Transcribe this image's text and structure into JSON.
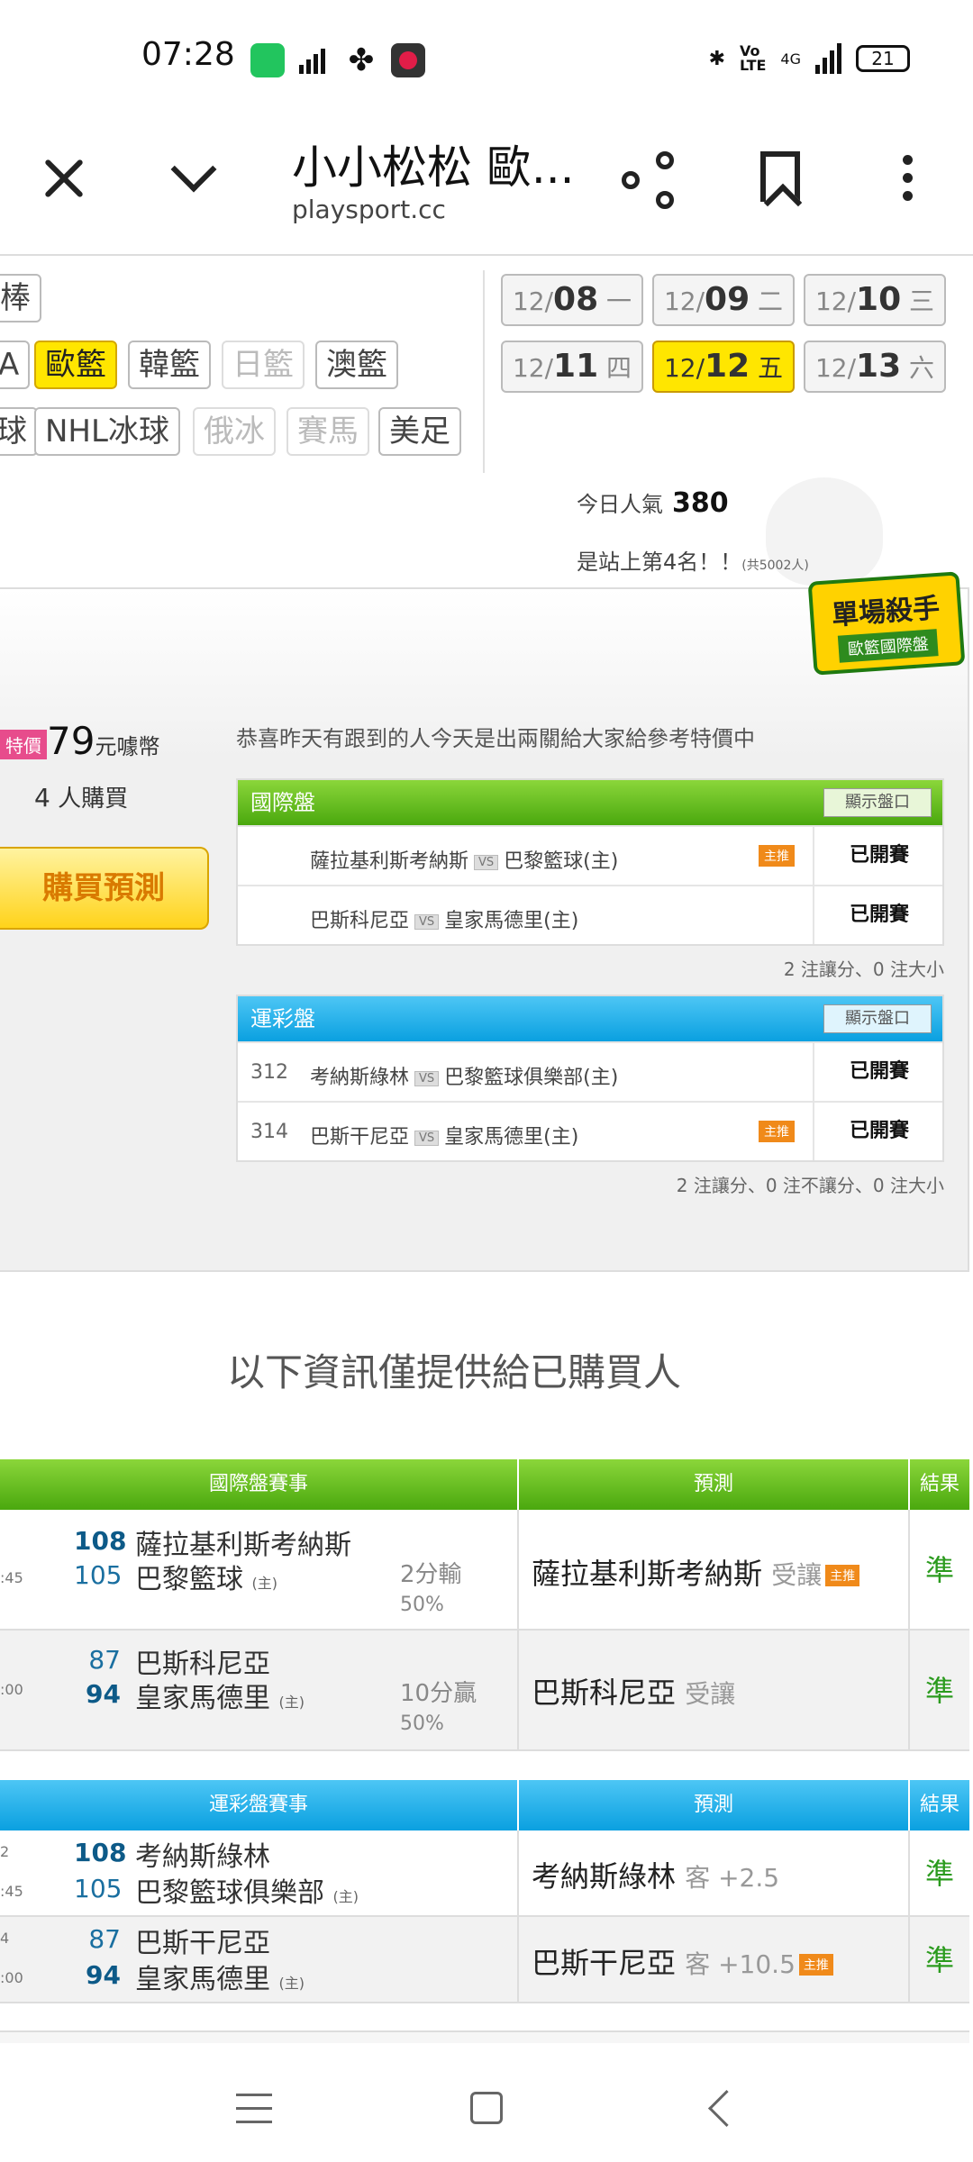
{
  "status_bar": {
    "time": "07:28",
    "battery": "21",
    "network": "4G"
  },
  "browser": {
    "title": "小小松松 歐...",
    "url": "playsport.cc"
  },
  "sports": {
    "row1": [
      "棒"
    ],
    "row2": [
      "A",
      "歐籃",
      "韓籃",
      "日籃",
      "澳籃"
    ],
    "row3": [
      "球",
      "NHL冰球",
      "俄冰",
      "賽馬",
      "美足"
    ]
  },
  "dates": [
    {
      "md": "12/",
      "d": "08",
      "w": "一"
    },
    {
      "md": "12/",
      "d": "09",
      "w": "二"
    },
    {
      "md": "12/",
      "d": "10",
      "w": "三"
    },
    {
      "md": "12/",
      "d": "11",
      "w": "四"
    },
    {
      "md": "12/",
      "d": "12",
      "w": "五"
    },
    {
      "md": "12/",
      "d": "13",
      "w": "六"
    }
  ],
  "popularity": {
    "label": "今日人氣",
    "value": "380",
    "rank": "是站上第4名！！",
    "total": "(共5002人)"
  },
  "badge": {
    "title": "單場殺手",
    "subtitle": "歐籃國際盤"
  },
  "offer": {
    "special": "特價",
    "price": "79",
    "unit": "元噱幣",
    "buyers_num": "4",
    "buyers_label": "人購買",
    "buy_button": "購買預測",
    "note": "恭喜昨天有跟到的人今天是出兩關給大家給參考特價中"
  },
  "intl": {
    "title": "國際盤",
    "toggle": "顯示盤口",
    "rows": [
      {
        "no": "",
        "away": "薩拉基利斯考納斯",
        "vs": "VS",
        "home": "巴黎籃球(主)",
        "master": "主推",
        "status": "已開賽"
      },
      {
        "no": "",
        "away": "巴斯科尼亞",
        "vs": "VS",
        "home": "皇家馬德里(主)",
        "master": "",
        "status": "已開賽"
      }
    ],
    "summary": "2 注讓分、0 注大小"
  },
  "lottery": {
    "title": "運彩盤",
    "toggle": "顯示盤口",
    "rows": [
      {
        "no": "312",
        "away": "考納斯綠林",
        "vs": "VS",
        "home": "巴黎籃球俱樂部(主)",
        "master": "",
        "status": "已開賽"
      },
      {
        "no": "314",
        "away": "巴斯干尼亞",
        "vs": "VS",
        "home": "皇家馬德里(主)",
        "master": "主推",
        "status": "已開賽"
      }
    ],
    "summary": "2 注讓分、0 注不讓分、0 注大小"
  },
  "info_text": "以下資訊僅提供給已購買人",
  "results_intl": {
    "headers": [
      "國際盤賽事",
      "預測",
      "結果"
    ],
    "rows": [
      {
        "time": ":45",
        "s1": "108",
        "t1": "薩拉基利斯考納斯",
        "s2": "105",
        "t2": "巴黎籃球",
        "home": "(主)",
        "res1": "2分輸",
        "res2": "50%",
        "pick": "薩拉基利斯考納斯",
        "pick_type": "受讓",
        "master": "主推",
        "result": "準"
      },
      {
        "time": ":00",
        "s1": "87",
        "t1": "巴斯科尼亞",
        "s2": "94",
        "t2": "皇家馬德里",
        "home": "(主)",
        "res1": "10分贏",
        "res2": "50%",
        "pick": "巴斯科尼亞",
        "pick_type": "受讓",
        "master": "",
        "result": "準"
      }
    ]
  },
  "results_lottery": {
    "headers": [
      "運彩盤賽事",
      "預測",
      "結果"
    ],
    "rows": [
      {
        "time1": "2",
        "time": ":45",
        "s1": "108",
        "t1": "考納斯綠林",
        "s2": "105",
        "t2": "巴黎籃球俱樂部",
        "home": "(主)",
        "pick": "考納斯綠林",
        "pick_type": "客 +2.5",
        "master": "",
        "result": "準"
      },
      {
        "time1": "4",
        "time": ":00",
        "s1": "87",
        "t1": "巴斯干尼亞",
        "s2": "94",
        "t2": "皇家馬德里",
        "home": "(主)",
        "pick": "巴斯干尼亞",
        "pick_type": "客 +10.5",
        "master": "主推",
        "result": "準"
      }
    ]
  }
}
